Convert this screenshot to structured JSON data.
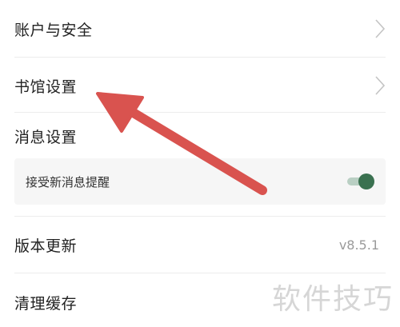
{
  "settings": {
    "items": [
      {
        "label": "账户与安全"
      },
      {
        "label": "书馆设置"
      },
      {
        "label": "消息设置"
      },
      {
        "label": "版本更新",
        "value": "v8.5.1"
      },
      {
        "label": "清理缓存"
      }
    ],
    "message_sub": {
      "label": "接受新消息提醒",
      "toggle_on": true
    }
  },
  "watermark": "软件技巧",
  "colors": {
    "arrow": "#d9534f",
    "toggle_knob": "#3a7150",
    "toggle_track": "#b9cfc3"
  },
  "icons": {
    "chevron": "chevron-right-icon"
  }
}
